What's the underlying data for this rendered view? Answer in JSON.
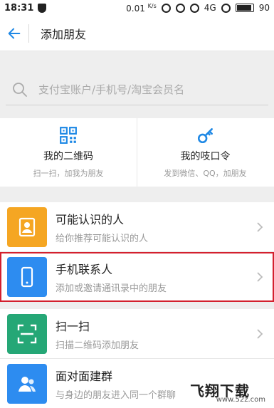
{
  "status_bar": {
    "time": "18:31",
    "net_speed": "0.01",
    "net_unit": "K/s",
    "network_type": "4G",
    "battery": "90"
  },
  "nav": {
    "title": "添加朋友",
    "back_icon": "arrow-left-icon"
  },
  "search": {
    "placeholder": "支付宝账户/手机号/淘宝会员名",
    "icon": "search-icon"
  },
  "quick_actions": [
    {
      "label": "我的二维码",
      "sub": "扫一扫，加我为朋友",
      "icon": "qrcode-icon"
    },
    {
      "label": "我的吱口令",
      "sub": "发到微信、QQ，加朋友",
      "icon": "key-icon"
    }
  ],
  "list": [
    {
      "title": "可能认识的人",
      "sub": "给你推荐可能认识的人",
      "icon": "contact-card-icon",
      "color": "#f5a623",
      "highlighted": false
    },
    {
      "title": "手机联系人",
      "sub": "添加或邀请通讯录中的朋友",
      "icon": "phone-icon",
      "color": "#2d8cf0",
      "highlighted": true
    },
    {
      "title": "扫一扫",
      "sub": "扫描二维码添加朋友",
      "icon": "scan-icon",
      "color": "#25a776",
      "highlighted": false
    },
    {
      "title": "面对面建群",
      "sub": "与身边的朋友进入同一个群聊",
      "icon": "group-icon",
      "color": "#2d8cf0",
      "highlighted": false
    }
  ],
  "watermark": {
    "logo": "飞翔下载",
    "url": "www.52z.com"
  },
  "colors": {
    "accent": "#1e88e5",
    "highlight_border": "#d3202e"
  }
}
